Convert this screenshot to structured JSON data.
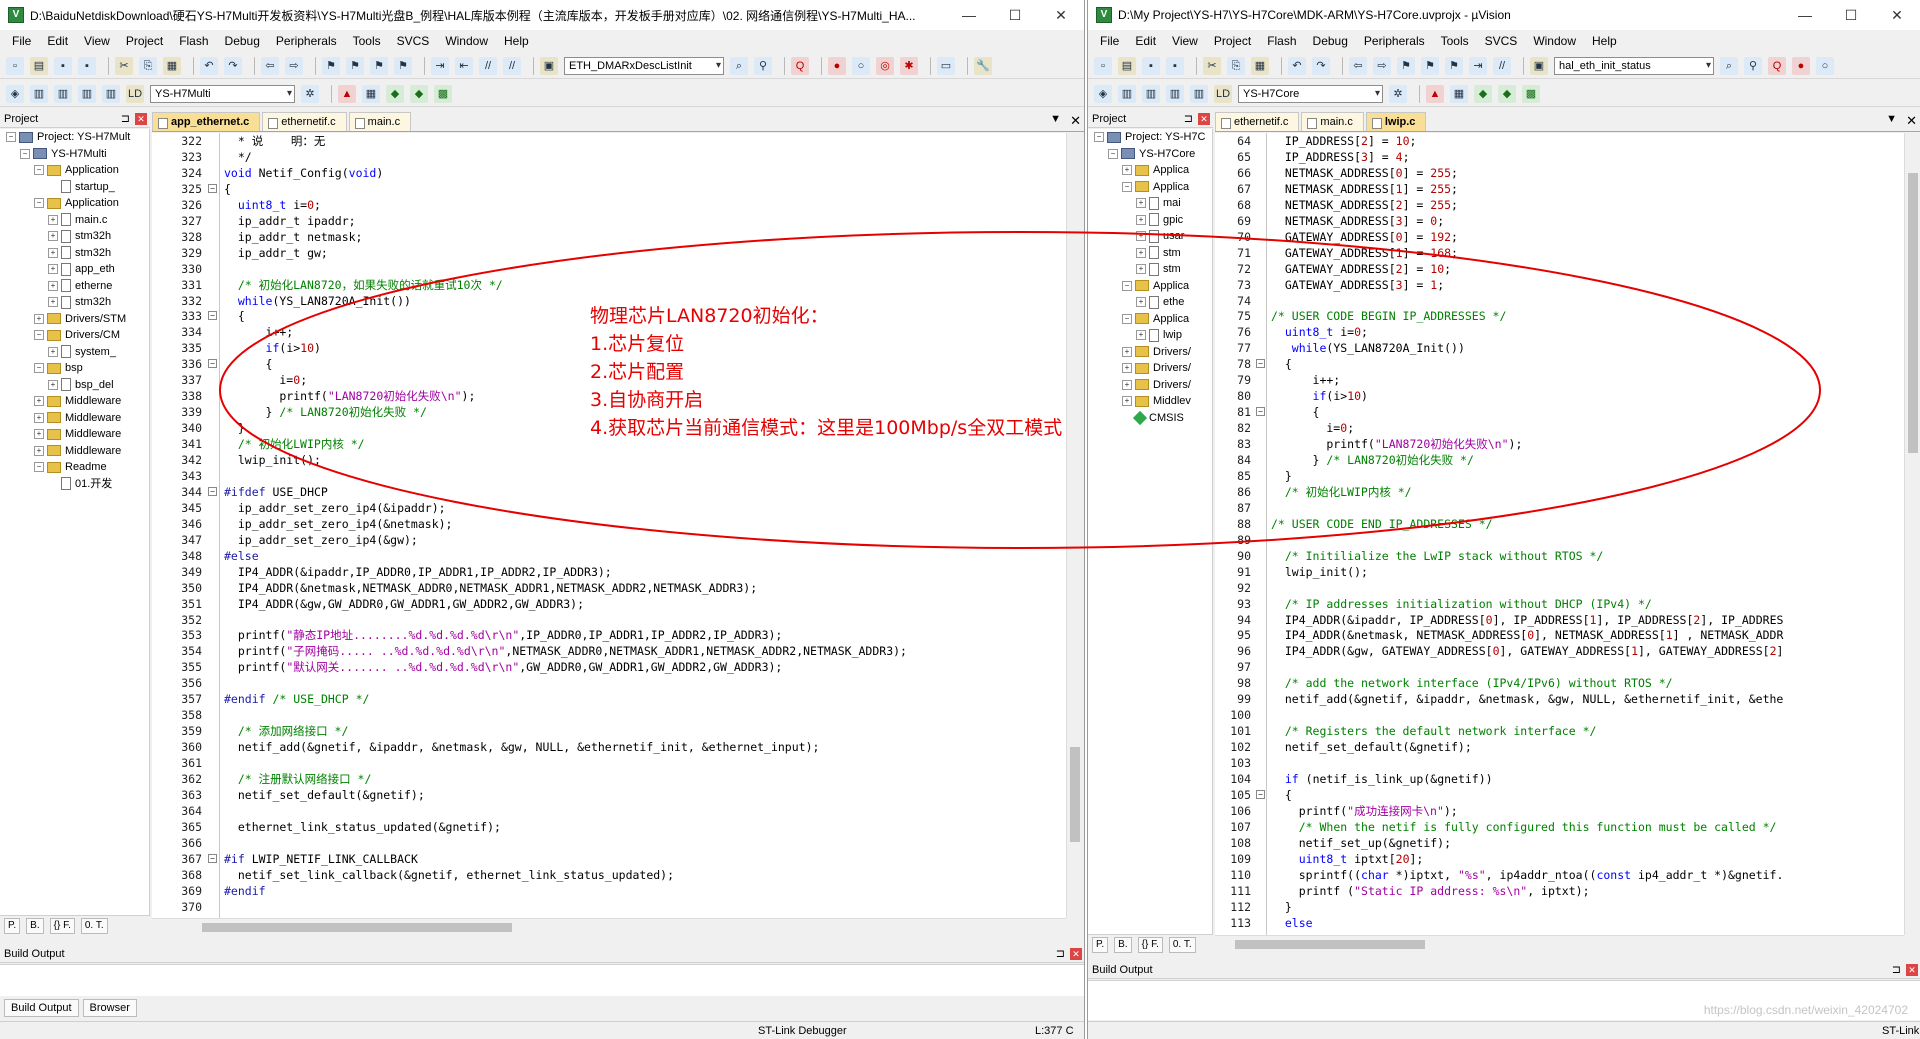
{
  "left": {
    "title": "D:\\BaiduNetdiskDownload\\硬石YS-H7Multi开发板资料\\YS-H7Multi光盘B_例程\\HAL库版本例程（主流库版本，开发板手册对应库）\\02. 网络通信例程\\YS-H7Multi_HA...",
    "win_controls": {
      "min": "—",
      "max": "☐",
      "close": "✕"
    },
    "menu": [
      "File",
      "Edit",
      "View",
      "Project",
      "Flash",
      "Debug",
      "Peripherals",
      "Tools",
      "SVCS",
      "Window",
      "Help"
    ],
    "toolbar_combo": "ETH_DMARxDescListInit",
    "target_combo": "YS-H7Multi",
    "project_header": "Project",
    "tree": [
      {
        "level": 0,
        "exp": "−",
        "icon": "proj",
        "label": "Project: YS-H7Mult"
      },
      {
        "level": 1,
        "exp": "−",
        "icon": "proj",
        "label": "YS-H7Multi"
      },
      {
        "level": 2,
        "exp": "−",
        "icon": "folder",
        "label": "Application"
      },
      {
        "level": 3,
        "exp": "",
        "icon": "file",
        "label": "startup_"
      },
      {
        "level": 2,
        "exp": "−",
        "icon": "folder",
        "label": "Application"
      },
      {
        "level": 3,
        "exp": "+",
        "icon": "file",
        "label": "main.c"
      },
      {
        "level": 3,
        "exp": "+",
        "icon": "file",
        "label": "stm32h"
      },
      {
        "level": 3,
        "exp": "+",
        "icon": "file",
        "label": "stm32h"
      },
      {
        "level": 3,
        "exp": "+",
        "icon": "file",
        "label": "app_eth"
      },
      {
        "level": 3,
        "exp": "+",
        "icon": "file",
        "label": "etherne"
      },
      {
        "level": 3,
        "exp": "+",
        "icon": "file",
        "label": "stm32h"
      },
      {
        "level": 2,
        "exp": "+",
        "icon": "folder",
        "label": "Drivers/STM"
      },
      {
        "level": 2,
        "exp": "−",
        "icon": "folder",
        "label": "Drivers/CM"
      },
      {
        "level": 3,
        "exp": "+",
        "icon": "file",
        "label": "system_"
      },
      {
        "level": 2,
        "exp": "−",
        "icon": "folder",
        "label": "bsp"
      },
      {
        "level": 3,
        "exp": "+",
        "icon": "file",
        "label": "bsp_del"
      },
      {
        "level": 2,
        "exp": "+",
        "icon": "folder",
        "label": "Middleware"
      },
      {
        "level": 2,
        "exp": "+",
        "icon": "folder",
        "label": "Middleware"
      },
      {
        "level": 2,
        "exp": "+",
        "icon": "folder",
        "label": "Middleware"
      },
      {
        "level": 2,
        "exp": "+",
        "icon": "folder",
        "label": "Middleware"
      },
      {
        "level": 2,
        "exp": "−",
        "icon": "folder",
        "label": "Readme"
      },
      {
        "level": 3,
        "exp": "",
        "icon": "file",
        "label": "01.开发"
      }
    ],
    "tree_tabs": [
      "P.",
      "B.",
      "{} F.",
      "0. T."
    ],
    "tabs": [
      {
        "label": "app_ethernet.c",
        "active": true
      },
      {
        "label": "ethernetif.c",
        "active": false
      },
      {
        "label": "main.c",
        "active": false
      }
    ],
    "code": [
      {
        "n": "322",
        "f": "",
        "t": "  * 说    明：无"
      },
      {
        "n": "323",
        "f": "",
        "t": "  */"
      },
      {
        "n": "324",
        "f": "",
        "t": "void Netif_Config(void)"
      },
      {
        "n": "325",
        "f": "−",
        "t": "{"
      },
      {
        "n": "326",
        "f": "",
        "t": "  uint8_t i=0;"
      },
      {
        "n": "327",
        "f": "",
        "t": "  ip_addr_t ipaddr;"
      },
      {
        "n": "328",
        "f": "",
        "t": "  ip_addr_t netmask;"
      },
      {
        "n": "329",
        "f": "",
        "t": "  ip_addr_t gw;"
      },
      {
        "n": "330",
        "f": "",
        "t": ""
      },
      {
        "n": "331",
        "f": "",
        "t": "  /* 初始化LAN8720，如果失败的话就重试10次 */"
      },
      {
        "n": "332",
        "f": "",
        "t": "  while(YS_LAN8720A_Init())"
      },
      {
        "n": "333",
        "f": "−",
        "t": "  {"
      },
      {
        "n": "334",
        "f": "",
        "t": "      i++;"
      },
      {
        "n": "335",
        "f": "",
        "t": "      if(i>10)"
      },
      {
        "n": "336",
        "f": "−",
        "t": "      {"
      },
      {
        "n": "337",
        "f": "",
        "t": "        i=0;"
      },
      {
        "n": "338",
        "f": "",
        "t": "        printf(\"LAN8720初始化失败\\n\");"
      },
      {
        "n": "339",
        "f": "",
        "t": "      } /* LAN8720初始化失败 */"
      },
      {
        "n": "340",
        "f": "",
        "t": "  }"
      },
      {
        "n": "341",
        "f": "",
        "t": "  /* 初始化LWIP内核 */"
      },
      {
        "n": "342",
        "f": "",
        "t": "  lwip_init();"
      },
      {
        "n": "343",
        "f": "",
        "t": ""
      },
      {
        "n": "344",
        "f": "−",
        "t": "#ifdef USE_DHCP"
      },
      {
        "n": "345",
        "f": "",
        "t": "  ip_addr_set_zero_ip4(&ipaddr);"
      },
      {
        "n": "346",
        "f": "",
        "t": "  ip_addr_set_zero_ip4(&netmask);"
      },
      {
        "n": "347",
        "f": "",
        "t": "  ip_addr_set_zero_ip4(&gw);"
      },
      {
        "n": "348",
        "f": "",
        "t": "#else"
      },
      {
        "n": "349",
        "f": "",
        "t": "  IP4_ADDR(&ipaddr,IP_ADDR0,IP_ADDR1,IP_ADDR2,IP_ADDR3);"
      },
      {
        "n": "350",
        "f": "",
        "t": "  IP4_ADDR(&netmask,NETMASK_ADDR0,NETMASK_ADDR1,NETMASK_ADDR2,NETMASK_ADDR3);"
      },
      {
        "n": "351",
        "f": "",
        "t": "  IP4_ADDR(&gw,GW_ADDR0,GW_ADDR1,GW_ADDR2,GW_ADDR3);"
      },
      {
        "n": "352",
        "f": "",
        "t": ""
      },
      {
        "n": "353",
        "f": "",
        "t": "  printf(\"静态IP地址........%d.%d.%d.%d\\r\\n\",IP_ADDR0,IP_ADDR1,IP_ADDR2,IP_ADDR3);"
      },
      {
        "n": "354",
        "f": "",
        "t": "  printf(\"子网掩码..... ..%d.%d.%d.%d\\r\\n\",NETMASK_ADDR0,NETMASK_ADDR1,NETMASK_ADDR2,NETMASK_ADDR3);"
      },
      {
        "n": "355",
        "f": "",
        "t": "  printf(\"默认网关....... ..%d.%d.%d.%d\\r\\n\",GW_ADDR0,GW_ADDR1,GW_ADDR2,GW_ADDR3);"
      },
      {
        "n": "356",
        "f": "",
        "t": ""
      },
      {
        "n": "357",
        "f": "",
        "t": "#endif /* USE_DHCP */"
      },
      {
        "n": "358",
        "f": "",
        "t": ""
      },
      {
        "n": "359",
        "f": "",
        "t": "  /* 添加网络接口 */"
      },
      {
        "n": "360",
        "f": "",
        "t": "  netif_add(&gnetif, &ipaddr, &netmask, &gw, NULL, &ethernetif_init, &ethernet_input);"
      },
      {
        "n": "361",
        "f": "",
        "t": ""
      },
      {
        "n": "362",
        "f": "",
        "t": "  /* 注册默认网络接口 */"
      },
      {
        "n": "363",
        "f": "",
        "t": "  netif_set_default(&gnetif);"
      },
      {
        "n": "364",
        "f": "",
        "t": ""
      },
      {
        "n": "365",
        "f": "",
        "t": "  ethernet_link_status_updated(&gnetif);"
      },
      {
        "n": "366",
        "f": "",
        "t": ""
      },
      {
        "n": "367",
        "f": "−",
        "t": "#if LWIP_NETIF_LINK_CALLBACK"
      },
      {
        "n": "368",
        "f": "",
        "t": "  netif_set_link_callback(&gnetif, ethernet_link_status_updated);"
      },
      {
        "n": "369",
        "f": "",
        "t": "#endif"
      },
      {
        "n": "370",
        "f": "",
        "t": ""
      }
    ],
    "build_output_label": "Build Output",
    "bottom_tabs": [
      "Build Output",
      "Browser"
    ],
    "status_debugger": "ST-Link Debugger",
    "status_line": "L:377 C"
  },
  "right": {
    "title": "D:\\My Project\\YS-H7\\YS-H7Core\\MDK-ARM\\YS-H7Core.uvprojx - µVision",
    "win_controls": {
      "min": "—",
      "max": "☐",
      "close": "✕"
    },
    "menu": [
      "File",
      "Edit",
      "View",
      "Project",
      "Flash",
      "Debug",
      "Peripherals",
      "Tools",
      "SVCS",
      "Window",
      "Help"
    ],
    "toolbar_combo": "hal_eth_init_status",
    "target_combo": "YS-H7Core",
    "project_header": "Project",
    "tree": [
      {
        "level": 0,
        "exp": "−",
        "icon": "proj",
        "label": "Project: YS-H7C"
      },
      {
        "level": 1,
        "exp": "−",
        "icon": "proj",
        "label": "YS-H7Core"
      },
      {
        "level": 2,
        "exp": "+",
        "icon": "folder",
        "label": "Applica"
      },
      {
        "level": 2,
        "exp": "−",
        "icon": "folder",
        "label": "Applica"
      },
      {
        "level": 3,
        "exp": "+",
        "icon": "file",
        "label": "mai"
      },
      {
        "level": 3,
        "exp": "+",
        "icon": "file",
        "label": "gpic"
      },
      {
        "level": 3,
        "exp": "+",
        "icon": "file",
        "label": "usar"
      },
      {
        "level": 3,
        "exp": "+",
        "icon": "file",
        "label": "stm"
      },
      {
        "level": 3,
        "exp": "+",
        "icon": "file",
        "label": "stm"
      },
      {
        "level": 2,
        "exp": "−",
        "icon": "folder",
        "label": "Applica"
      },
      {
        "level": 3,
        "exp": "+",
        "icon": "file",
        "label": "ethe"
      },
      {
        "level": 2,
        "exp": "−",
        "icon": "folder",
        "label": "Applica"
      },
      {
        "level": 3,
        "exp": "+",
        "icon": "file",
        "label": "lwip"
      },
      {
        "level": 2,
        "exp": "+",
        "icon": "folder",
        "label": "Drivers/"
      },
      {
        "level": 2,
        "exp": "+",
        "icon": "folder",
        "label": "Drivers/"
      },
      {
        "level": 2,
        "exp": "+",
        "icon": "folder",
        "label": "Drivers/"
      },
      {
        "level": 2,
        "exp": "+",
        "icon": "folder",
        "label": "Middlev"
      },
      {
        "level": 2,
        "exp": "",
        "icon": "gem",
        "label": "CMSIS"
      }
    ],
    "tree_tabs": [
      "P.",
      "B.",
      "{} F.",
      "0. T."
    ],
    "tabs": [
      {
        "label": "ethernetif.c",
        "active": false
      },
      {
        "label": "main.c",
        "active": false
      },
      {
        "label": "lwip.c",
        "active": true
      }
    ],
    "code": [
      {
        "n": "64",
        "f": "",
        "t": "  IP_ADDRESS[2] = 10;"
      },
      {
        "n": "65",
        "f": "",
        "t": "  IP_ADDRESS[3] = 4;"
      },
      {
        "n": "66",
        "f": "",
        "t": "  NETMASK_ADDRESS[0] = 255;"
      },
      {
        "n": "67",
        "f": "",
        "t": "  NETMASK_ADDRESS[1] = 255;"
      },
      {
        "n": "68",
        "f": "",
        "t": "  NETMASK_ADDRESS[2] = 255;"
      },
      {
        "n": "69",
        "f": "",
        "t": "  NETMASK_ADDRESS[3] = 0;"
      },
      {
        "n": "70",
        "f": "",
        "t": "  GATEWAY_ADDRESS[0] = 192;"
      },
      {
        "n": "71",
        "f": "",
        "t": "  GATEWAY_ADDRESS[1] = 168;"
      },
      {
        "n": "72",
        "f": "",
        "t": "  GATEWAY_ADDRESS[2] = 10;"
      },
      {
        "n": "73",
        "f": "",
        "t": "  GATEWAY_ADDRESS[3] = 1;"
      },
      {
        "n": "74",
        "f": "",
        "t": ""
      },
      {
        "n": "75",
        "f": "",
        "t": "/* USER CODE BEGIN IP_ADDRESSES */"
      },
      {
        "n": "76",
        "f": "",
        "t": "  uint8_t i=0;"
      },
      {
        "n": "77",
        "f": "",
        "t": "   while(YS_LAN8720A_Init())"
      },
      {
        "n": "78",
        "f": "−",
        "t": "  {"
      },
      {
        "n": "79",
        "f": "",
        "t": "      i++;"
      },
      {
        "n": "80",
        "f": "",
        "t": "      if(i>10)"
      },
      {
        "n": "81",
        "f": "−",
        "t": "      {"
      },
      {
        "n": "82",
        "f": "",
        "t": "        i=0;"
      },
      {
        "n": "83",
        "f": "",
        "t": "        printf(\"LAN8720初始化失败\\n\");"
      },
      {
        "n": "84",
        "f": "",
        "t": "      } /* LAN8720初始化失败 */"
      },
      {
        "n": "85",
        "f": "",
        "t": "  }"
      },
      {
        "n": "86",
        "f": "",
        "t": "  /* 初始化LWIP内核 */"
      },
      {
        "n": "87",
        "f": "",
        "t": ""
      },
      {
        "n": "88",
        "f": "",
        "t": "/* USER CODE END IP_ADDRESSES */"
      },
      {
        "n": "89",
        "f": "",
        "t": ""
      },
      {
        "n": "90",
        "f": "",
        "t": "  /* Initilialize the LwIP stack without RTOS */"
      },
      {
        "n": "91",
        "f": "",
        "t": "  lwip_init();"
      },
      {
        "n": "92",
        "f": "",
        "t": ""
      },
      {
        "n": "93",
        "f": "",
        "t": "  /* IP addresses initialization without DHCP (IPv4) */"
      },
      {
        "n": "94",
        "f": "",
        "t": "  IP4_ADDR(&ipaddr, IP_ADDRESS[0], IP_ADDRESS[1], IP_ADDRESS[2], IP_ADDRES"
      },
      {
        "n": "95",
        "f": "",
        "t": "  IP4_ADDR(&netmask, NETMASK_ADDRESS[0], NETMASK_ADDRESS[1] , NETMASK_ADDR"
      },
      {
        "n": "96",
        "f": "",
        "t": "  IP4_ADDR(&gw, GATEWAY_ADDRESS[0], GATEWAY_ADDRESS[1], GATEWAY_ADDRESS[2]"
      },
      {
        "n": "97",
        "f": "",
        "t": ""
      },
      {
        "n": "98",
        "f": "",
        "t": "  /* add the network interface (IPv4/IPv6) without RTOS */"
      },
      {
        "n": "99",
        "f": "",
        "t": "  netif_add(&gnetif, &ipaddr, &netmask, &gw, NULL, &ethernetif_init, &ethe"
      },
      {
        "n": "100",
        "f": "",
        "t": ""
      },
      {
        "n": "101",
        "f": "",
        "t": "  /* Registers the default network interface */"
      },
      {
        "n": "102",
        "f": "",
        "t": "  netif_set_default(&gnetif);"
      },
      {
        "n": "103",
        "f": "",
        "t": ""
      },
      {
        "n": "104",
        "f": "",
        "t": "  if (netif_is_link_up(&gnetif))"
      },
      {
        "n": "105",
        "f": "−",
        "t": "  {"
      },
      {
        "n": "106",
        "f": "",
        "t": "    printf(\"成功连接网卡\\n\");"
      },
      {
        "n": "107",
        "f": "",
        "t": "    /* When the netif is fully configured this function must be called */"
      },
      {
        "n": "108",
        "f": "",
        "t": "    netif_set_up(&gnetif);"
      },
      {
        "n": "109",
        "f": "",
        "t": "    uint8_t iptxt[20];"
      },
      {
        "n": "110",
        "f": "",
        "t": "    sprintf((char *)iptxt, \"%s\", ip4addr_ntoa((const ip4_addr_t *)&gnetif."
      },
      {
        "n": "111",
        "f": "",
        "t": "    printf (\"Static IP address: %s\\n\", iptxt);"
      },
      {
        "n": "112",
        "f": "",
        "t": "  }"
      },
      {
        "n": "113",
        "f": "",
        "t": "  else"
      }
    ],
    "build_output_label": "Build Output",
    "status_debugger": "ST-Link De"
  },
  "annotation": {
    "lines": [
      "物理芯片LAN8720初始化：",
      "1.芯片复位",
      "2.芯片配置",
      "3.自协商开启",
      "4.获取芯片当前通信模式：这里是100Mbp/s全双工模式"
    ],
    "color": "#e60000"
  },
  "watermark": "https://blog.csdn.net/weixin_42024702",
  "colors": {
    "comment": "#008000",
    "string": "#a000a0",
    "keyword": "#0000ff",
    "preproc": "#1a1aa6",
    "number": "#b00000",
    "active_tab": "#f9df95"
  }
}
